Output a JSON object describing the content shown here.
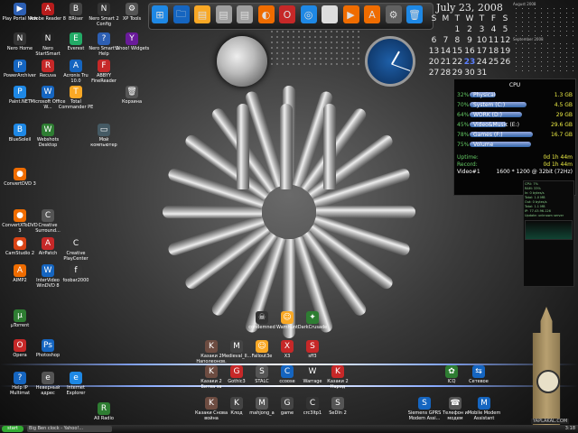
{
  "desktop": {
    "left_icons": [
      {
        "label": "Play Portal Now",
        "glyph": "▶",
        "color": "#2d5fb3"
      },
      {
        "label": "Adobe Reader 8",
        "glyph": "A",
        "color": "#b71c1c"
      },
      {
        "label": "BRiser",
        "glyph": "B",
        "color": "#444"
      },
      {
        "label": "Nero Smart 2 Config",
        "glyph": "N",
        "color": "#333"
      },
      {
        "label": "XP Tools",
        "glyph": "⚙",
        "color": "#555"
      },
      {
        "label": "Nero Home",
        "glyph": "N",
        "color": "#333"
      },
      {
        "label": "Nero StartSmart",
        "glyph": "N",
        "color": "#222"
      },
      {
        "label": "Everest",
        "glyph": "E",
        "color": "#2a6"
      },
      {
        "label": "Nero Smart 2 Help",
        "glyph": "?",
        "color": "#2d5fb3"
      },
      {
        "label": "Yahoo! Widgets",
        "glyph": "Y",
        "color": "#6a1b9a"
      },
      {
        "label": "PowerArchiver",
        "glyph": "P",
        "color": "#1565c0"
      },
      {
        "label": "Recuva",
        "glyph": "R",
        "color": "#c62828"
      },
      {
        "label": "Acronis Tru 10.0",
        "glyph": "A",
        "color": "#1565c0"
      },
      {
        "label": "ABBYY FineReader",
        "glyph": "F",
        "color": "#c62828"
      },
      {
        "label": "Paint.NET",
        "glyph": "P",
        "color": "#1e88e5"
      },
      {
        "label": "Microsoft Office W...",
        "glyph": "W",
        "color": "#1565c0"
      },
      {
        "label": "Total Commander PE",
        "glyph": "T",
        "color": "#f9a825"
      },
      {
        "label": "Корзина",
        "glyph": "🗑",
        "color": "#555"
      },
      {
        "label": "BlueSoleil",
        "glyph": "B",
        "color": "#1e88e5"
      },
      {
        "label": "Webshots Desktop",
        "glyph": "W",
        "color": "#2e7d32"
      },
      {
        "label": "Мой компьютер",
        "glyph": "▭",
        "color": "#455a64"
      },
      {
        "label": "ConvertDVD 3",
        "glyph": "●",
        "color": "#ef6c00"
      },
      {
        "label": "ConvertXToDVD 3",
        "glyph": "●",
        "color": "#ef6c00"
      },
      {
        "label": "Creative Surround...",
        "glyph": "C",
        "color": "#555"
      },
      {
        "label": "CamStudio 2",
        "glyph": "●",
        "color": "#d84315"
      },
      {
        "label": "AirPatch",
        "glyph": "A",
        "color": "#c62828"
      },
      {
        "label": "Creative PlayCenter",
        "glyph": "C",
        "color": "#333"
      },
      {
        "label": "AIMP2",
        "glyph": "A",
        "color": "#ef6c00"
      },
      {
        "label": "InterVideo WinDVD 8",
        "glyph": "W",
        "color": "#1565c0"
      },
      {
        "label": "foobar2000",
        "glyph": "f",
        "color": "#333"
      },
      {
        "label": "µTorrent",
        "glyph": "µ",
        "color": "#2e7d32"
      }
    ],
    "bottom_left_icons": [
      {
        "label": "Opera",
        "glyph": "O",
        "color": "#c62828"
      },
      {
        "label": "Photoshop",
        "glyph": "Ps",
        "color": "#1565c0"
      },
      {
        "label": "Help IP Multimat",
        "glyph": "?",
        "color": "#1565c0"
      },
      {
        "label": "Неверный адрес",
        "glyph": "e",
        "color": "#555"
      },
      {
        "label": "Internet Explorer",
        "glyph": "e",
        "color": "#1e88e5"
      },
      {
        "label": "All Radio",
        "glyph": "R",
        "color": "#2e7d32"
      }
    ],
    "center_icons": [
      {
        "label": "condemned",
        "glyph": "☠",
        "color": "#333"
      },
      {
        "label": "Wamhunt",
        "glyph": "☺",
        "color": "#f9a825"
      },
      {
        "label": "DarkCrusade",
        "glyph": "✦",
        "color": "#2e7d32"
      },
      {
        "label": "Казаки 2 Наполеонов.",
        "glyph": "K",
        "color": "#6d4c41"
      },
      {
        "label": "Medieval_II...",
        "glyph": "M",
        "color": "#444"
      },
      {
        "label": "Fallout3e",
        "glyph": "☺",
        "color": "#f9a825"
      },
      {
        "label": "X3",
        "glyph": "X",
        "color": "#c62828"
      },
      {
        "label": "sff3",
        "glyph": "S",
        "color": "#c62828"
      },
      {
        "label": "Казаки 2 Битва за Европу",
        "glyph": "K",
        "color": "#6d4c41"
      },
      {
        "label": "Gothic3",
        "glyph": "G",
        "color": "#c62828"
      },
      {
        "label": "STALC",
        "glyph": "S",
        "color": "#555"
      },
      {
        "label": "ccoose",
        "glyph": "C",
        "color": "#1565c0"
      },
      {
        "label": "Warrage",
        "glyph": "W",
        "color": "#333"
      },
      {
        "label": "Казаки 2 Народ",
        "glyph": "K",
        "color": "#c62828"
      },
      {
        "label": "Казаки Снова война",
        "glyph": "K",
        "color": "#6d4c41"
      },
      {
        "label": "Клод",
        "glyph": "K",
        "color": "#444"
      },
      {
        "label": "mahjong_a",
        "glyph": "M",
        "color": "#555"
      },
      {
        "label": "game",
        "glyph": "G",
        "color": "#444"
      },
      {
        "label": "crc3ltp1",
        "glyph": "C",
        "color": "#333"
      },
      {
        "label": "SeDIn 2",
        "glyph": "S",
        "color": "#555"
      }
    ],
    "bottom_right_icons": [
      {
        "label": "ICQ",
        "glyph": "✿",
        "color": "#2e7d32"
      },
      {
        "label": "Сетевое",
        "glyph": "⇆",
        "color": "#1565c0"
      },
      {
        "label": "Siemens GPRS Modem Assi...",
        "glyph": "S",
        "color": "#1565c0"
      },
      {
        "label": "Телефон и модем",
        "glyph": "☎",
        "color": "#555"
      },
      {
        "label": "Mobile Modem Assistant",
        "glyph": "M",
        "color": "#1565c0"
      }
    ]
  },
  "dock": {
    "items": [
      {
        "name": "windows-icon",
        "glyph": "⊞",
        "color": "#1e88e5"
      },
      {
        "name": "explorer-icon",
        "glyph": "🗀",
        "color": "#1565c0"
      },
      {
        "name": "folder-icon",
        "glyph": "▤",
        "color": "#f9a825"
      },
      {
        "name": "folder-icon",
        "glyph": "▤",
        "color": "#9e9e9e"
      },
      {
        "name": "folder-icon",
        "glyph": "▤",
        "color": "#9e9e9e"
      },
      {
        "name": "firefox-icon",
        "glyph": "◐",
        "color": "#ef6c00"
      },
      {
        "name": "opera-icon",
        "glyph": "O",
        "color": "#c62828"
      },
      {
        "name": "media-icon",
        "glyph": "◎",
        "color": "#1e88e5"
      },
      {
        "name": "play-icon",
        "glyph": "▶",
        "color": "#ddd"
      },
      {
        "name": "player-icon",
        "glyph": "▶",
        "color": "#ef6c00"
      },
      {
        "name": "aimp-icon",
        "glyph": "A",
        "color": "#ef6c00"
      },
      {
        "name": "settings-icon",
        "glyph": "⚙",
        "color": "#616161"
      },
      {
        "name": "recycle-bin-icon",
        "glyph": "🗑",
        "color": "#1e88e5"
      }
    ]
  },
  "calendar": {
    "title": "July 23, 2008",
    "weekdays": [
      "S",
      "M",
      "T",
      "W",
      "T",
      "F",
      "S"
    ],
    "weeks": [
      [
        "",
        "",
        "1",
        "2",
        "3",
        "4",
        "5"
      ],
      [
        "6",
        "7",
        "8",
        "9",
        "10",
        "11",
        "12"
      ],
      [
        "13",
        "14",
        "15",
        "16",
        "17",
        "18",
        "19"
      ],
      [
        "20",
        "21",
        "22",
        "23",
        "24",
        "25",
        "26"
      ],
      [
        "27",
        "28",
        "29",
        "30",
        "31",
        "",
        ""
      ]
    ],
    "today": "23"
  },
  "mini_calendars": {
    "august_title": "August 2008",
    "september_title": "September 2008"
  },
  "system_monitor": {
    "cpu_label": "CPU",
    "rows": [
      {
        "pct": "32%",
        "name": "Physical",
        "value": "1.3 GB",
        "fill": 0.32
      },
      {
        "pct": "70%",
        "name": "System (C:)",
        "value": "4.5 GB",
        "fill": 0.7
      },
      {
        "pct": "64%",
        "name": "WORK (D:)",
        "value": "29 GB",
        "fill": 0.64
      },
      {
        "pct": "45%",
        "name": "Video&Music (E:)",
        "value": "29.6 GB",
        "fill": 0.45
      },
      {
        "pct": "78%",
        "name": "Games (F:)",
        "value": "16.7 GB",
        "fill": 0.78
      },
      {
        "pct": "75%",
        "name": "Volume",
        "value": "",
        "fill": 0.75
      }
    ],
    "uptime_label": "Uptime:",
    "uptime_value": "0d 1h 44m",
    "record_label": "Record:",
    "record_value": "0d 1h 44m",
    "video_label": "Video#1",
    "video_value": "1600 * 1200 @ 32bit (72Hz)"
  },
  "cpu_widget": {
    "lines": [
      "CPU: 7%",
      "RAM: 33%",
      "In: 0 bytes/s",
      "Total: 1.0 MB",
      "Out: 0 bytes/s",
      "Total: 1.1 MB",
      "IP: 77.43.96.126",
      "Update: unknown server"
    ]
  },
  "taskbar": {
    "start": "start",
    "items": [
      "Big Ben clock - Yahoo!..."
    ],
    "clock": "3:18"
  },
  "watermark": "YAPLAKAL.COM"
}
